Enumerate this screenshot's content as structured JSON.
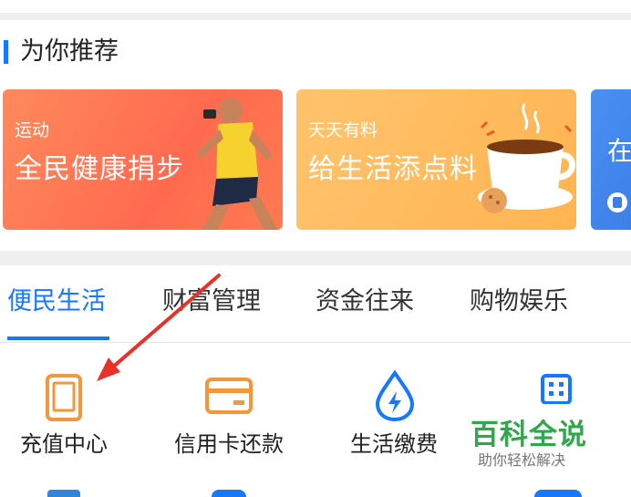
{
  "recommend": {
    "title": "为你推荐",
    "banners": [
      {
        "small": "运动",
        "big": "全民健康捐步"
      },
      {
        "small": "天天有料",
        "big": "给生活添点料"
      },
      {
        "big": "在"
      }
    ]
  },
  "tabs": [
    {
      "label": "便民生活",
      "active": true
    },
    {
      "label": "财富管理"
    },
    {
      "label": "资金往来"
    },
    {
      "label": "购物娱乐"
    }
  ],
  "services": [
    {
      "label": "充值中心",
      "icon": "phone-icon"
    },
    {
      "label": "信用卡还款",
      "icon": "credit-card-icon"
    },
    {
      "label": "生活缴费",
      "icon": "water-drop-bolt-icon"
    },
    {
      "label": "",
      "icon": "building-icon"
    }
  ],
  "watermark": {
    "title": "百科全说",
    "subtitle": "助你轻松解决"
  },
  "colors": {
    "accent": "#1677ff",
    "service_orange": "#f5963a",
    "service_blue": "#1677ff",
    "annotation_arrow": "#e8312a",
    "watermark_green": "#2fa84a"
  }
}
